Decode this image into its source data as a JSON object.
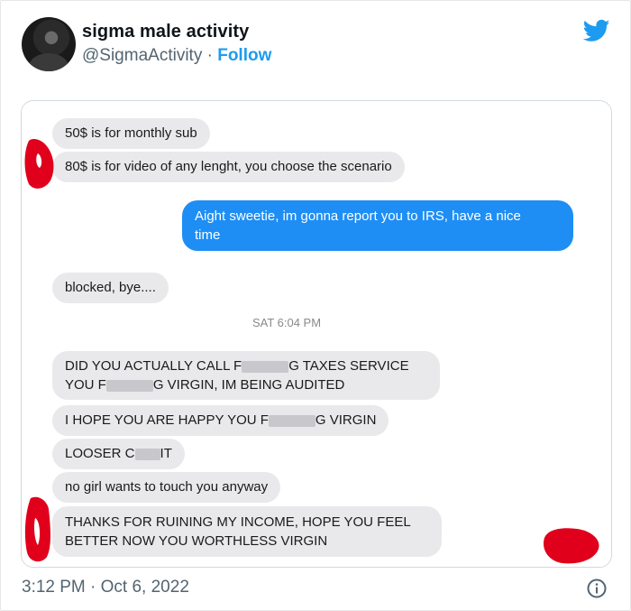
{
  "author": {
    "name": "sigma male activity",
    "handle": "@SigmaActivity",
    "separator": "·",
    "follow_label": "Follow"
  },
  "icons": {
    "twitter": "twitter-bird-icon",
    "info": "info-icon"
  },
  "colors": {
    "accent": "#1d9bf0",
    "sent_bubble": "#1e8ef5",
    "received_bubble": "#e9e9eb",
    "scribble": "#e0001b"
  },
  "chat": {
    "messages": [
      {
        "lines": [
          "50$ is for monthly sub"
        ]
      },
      {
        "lines": [
          "80$ is for video of any lenght, you choose the scenario"
        ]
      },
      {
        "lines": [
          "Aight sweetie, im gonna report you to IRS, have a nice",
          "time"
        ]
      },
      {
        "lines": [
          "blocked, bye...."
        ]
      }
    ],
    "timestamp": "SAT 6:04 PM",
    "later": [
      {
        "lines": [
          [
            "DID YOU ACTUALLY CALL F",
            "G TAXES SERVICE"
          ],
          [
            "YOU F",
            "G VIRGIN, IM BEING AUDITED"
          ]
        ]
      },
      {
        "parts": [
          "I HOPE YOU ARE HAPPY YOU F",
          "G VIRGIN"
        ]
      },
      {
        "parts": [
          "LOOSER C",
          "IT"
        ]
      },
      {
        "text": "no girl wants to touch you anyway"
      },
      {
        "lines": [
          "THANKS FOR RUINING MY INCOME, HOPE YOU FEEL",
          "BETTER NOW YOU WORTHLESS VIRGIN"
        ]
      }
    ]
  },
  "footer": {
    "time": "3:12 PM",
    "date": "Oct 6, 2022"
  }
}
